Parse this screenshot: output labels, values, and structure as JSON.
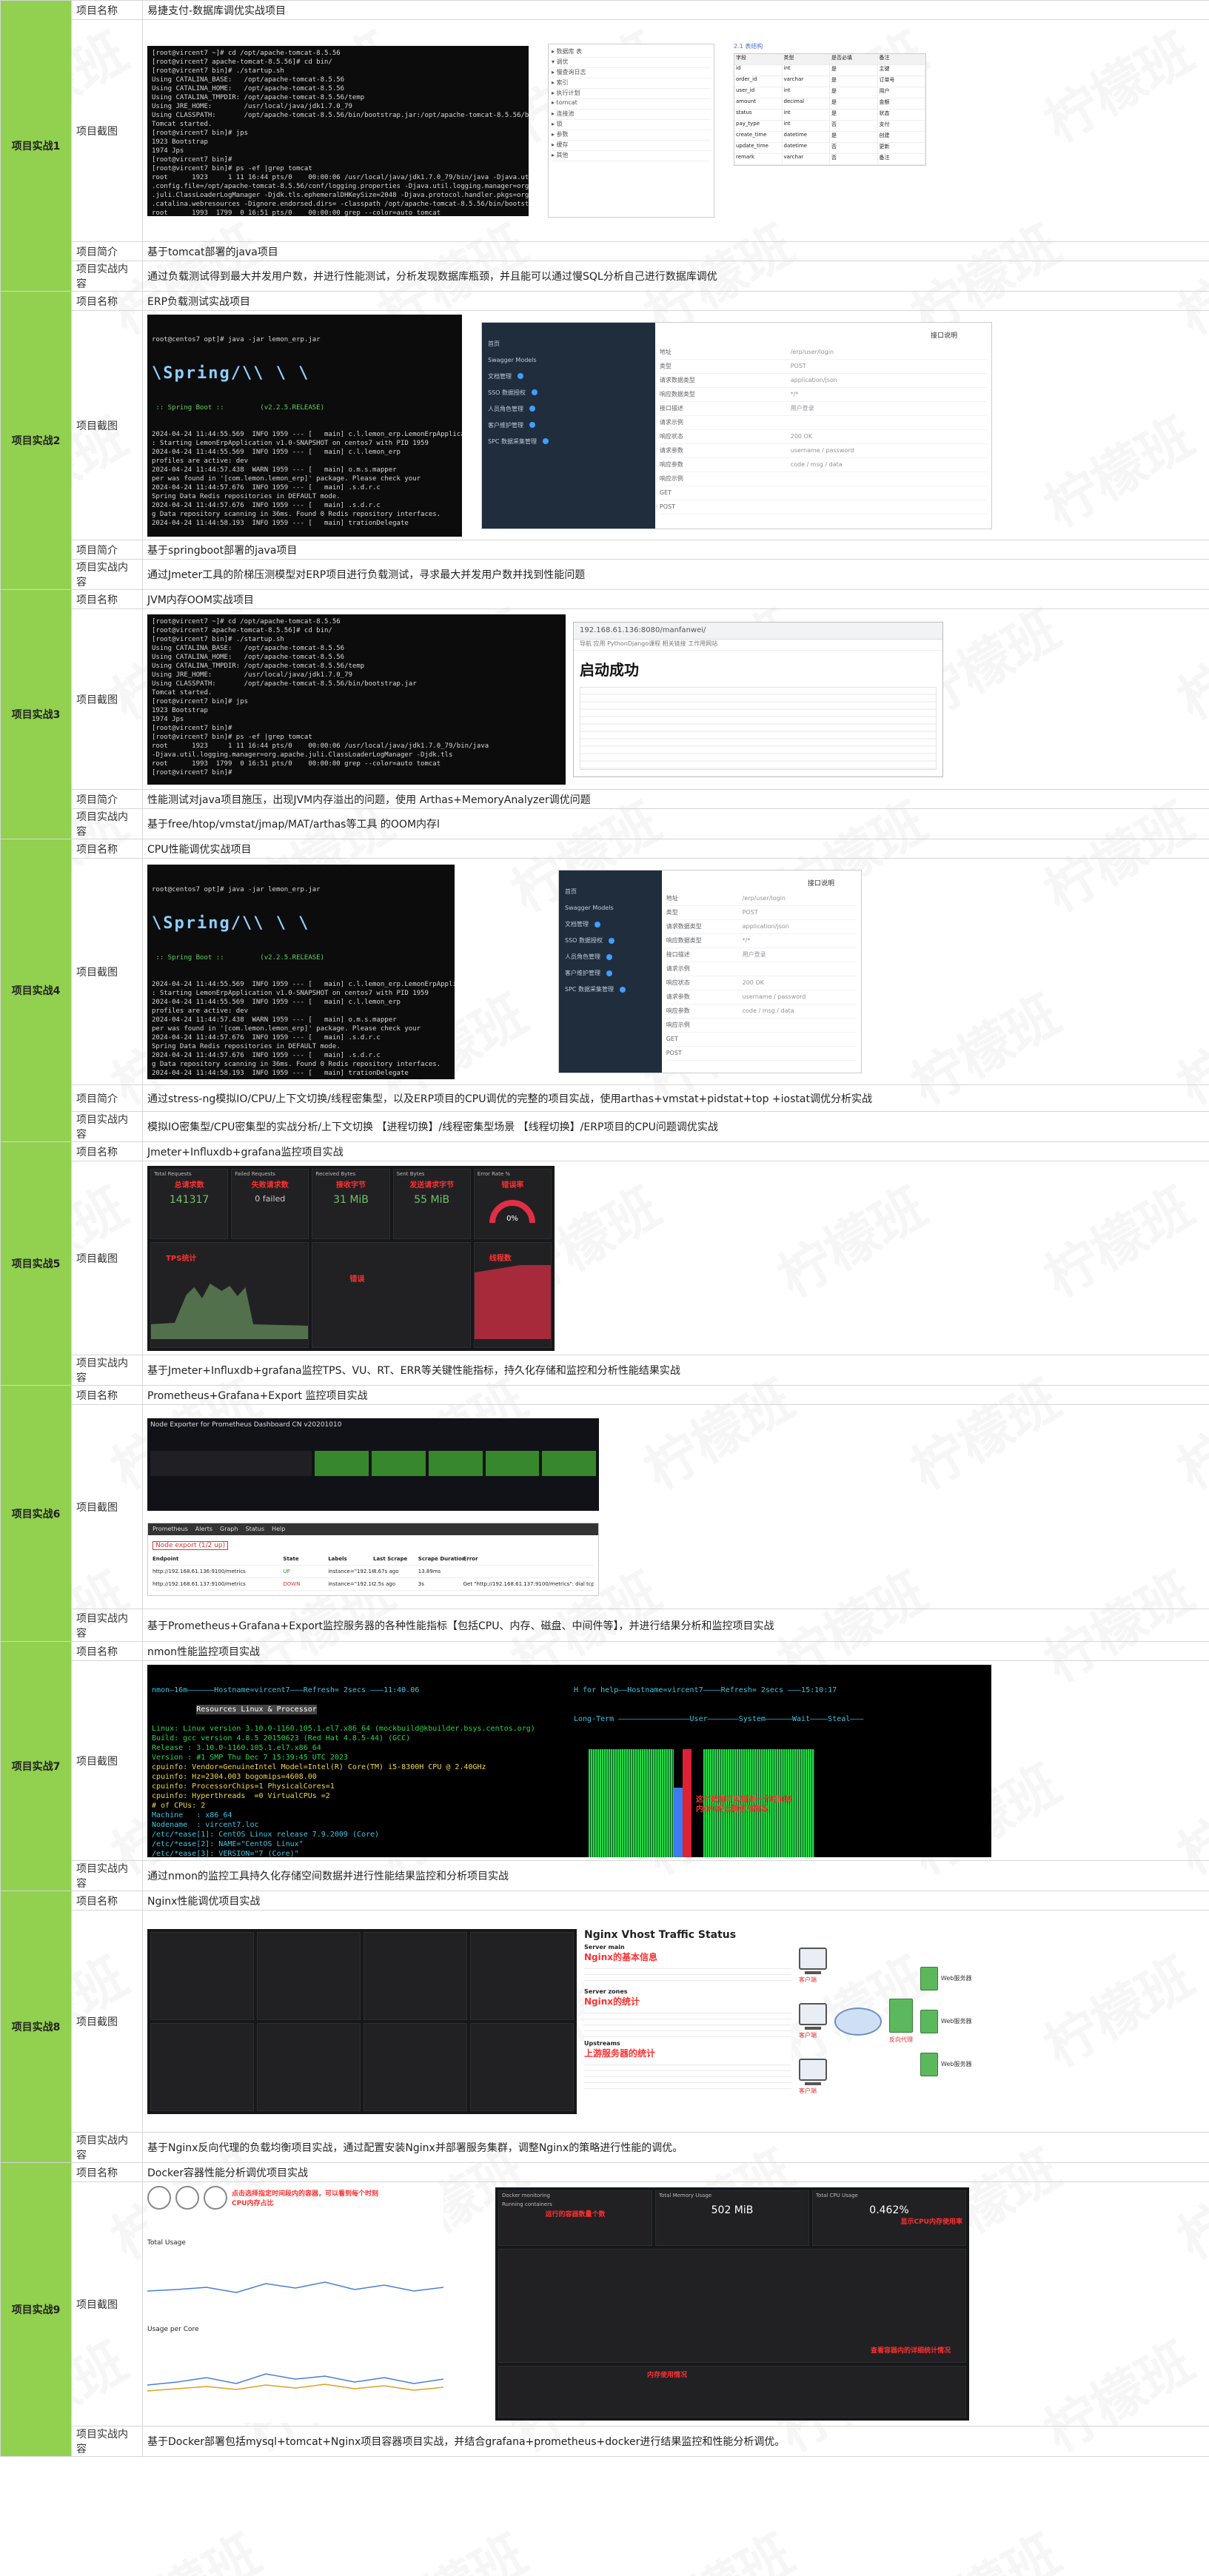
{
  "labels": {
    "name": "项目名称",
    "screenshot": "项目截图",
    "intro": "项目简介",
    "content": "项目实战内容"
  },
  "watermark": "柠檬班",
  "projects": [
    {
      "title": "项目实战1",
      "name": "易捷支付-数据库调优实战项目",
      "intro": "基于tomcat部署的java项目",
      "content": "通过负载测试得到最大并发用户数，并进行性能测试，分析发现数据库瓶颈，并且能可以通过慢SQL分析自己进行数据库调优"
    },
    {
      "title": "项目实战2",
      "name": "ERP负载测试实战项目",
      "intro": "基于springboot部署的java项目",
      "content": "通过Jmeter工具的阶梯压测模型对ERP项目进行负载测试，寻求最大并发用户数并找到性能问题"
    },
    {
      "title": "项目实战3",
      "name": "JVM内存OOM实战项目",
      "intro": "性能测试对java项目施压，出现JVM内存溢出的问题，使用 Arthas+MemoryAnalyzer调优问题",
      "content": "基于free/htop/vmstat/jmap/MAT/arthas等工具 的OOM内存l"
    },
    {
      "title": "项目实战4",
      "name": "CPU性能调优实战项目",
      "intro": "通过stress-ng模拟IO/CPU/上下文切换/线程密集型，以及ERP项目的CPU调优的完整的项目实战，使用arthas+vmstat+pidstat+top +iostat调优分析实战",
      "content": "模拟IO密集型/CPU密集型的实战分析/上下文切换 【进程切换】/线程密集型场景 【线程切换】/ERP项目的CPU问题调优实战"
    },
    {
      "title": "项目实战5",
      "name": "Jmeter+Influxdb+grafana监控项目实战",
      "content": "基于Jmeter+Influxdb+grafana监控TPS、VU、RT、ERR等关键性能指标，持久化存储和监控和分析性能结果实战"
    },
    {
      "title": "项目实战6",
      "name": "Prometheus+Grafana+Export 监控项目实战",
      "content": "基于Prometheus+Grafana+Export监控服务器的各种性能指标【包括CPU、内存、磁盘、中间件等】，并进行结果分析和监控项目实战"
    },
    {
      "title": "项目实战7",
      "name": "nmon性能监控项目实战",
      "content": "通过nmon的监控工具持久化存储空间数据并进行性能结果监控和分析项目实战"
    },
    {
      "title": "项目实战8",
      "name": "Nginx性能调优项目实战",
      "content": "基于Nginx反向代理的负载均衡项目实战，通过配置安装Nginx并部署服务集群，调整Nginx的策略进行性能的调优。"
    },
    {
      "title": "项目实战9",
      "name": "Docker容器性能分析调优项目实战",
      "content": "基于Docker部署包括mysql+tomcat+Nginx项目容器项目实战，并结合grafana+prometheus+docker进行结果监控和性能分析调优。"
    }
  ],
  "shots": {
    "p1": {
      "term": "[root@vircent7 ~]# cd /opt/apache-tomcat-8.5.56\n[root@vircent7 apache-tomcat-8.5.56]# cd bin/\n[root@vircent7 bin]# ./startup.sh\nUsing CATALINA_BASE:   /opt/apache-tomcat-8.5.56\nUsing CATALINA_HOME:   /opt/apache-tomcat-8.5.56\nUsing CATALINA_TMPDIR: /opt/apache-tomcat-8.5.56/temp\nUsing JRE_HOME:        /usr/local/java/jdk1.7.0_79\nUsing CLASSPATH:       /opt/apache-tomcat-8.5.56/bin/bootstrap.jar:/opt/apache-tomcat-8.5.56/bin/tomcat-juli.jar\nTomcat started.\n[root@vircent7 bin]# jps\n1923 Bootstrap\n1974 Jps\n[root@vircent7 bin]#\n[root@vircent7 bin]# ps -ef |grep tomcat\nroot      1923     1 11 16:44 pts/0    00:00:06 /usr/local/java/jdk1.7.0_79/bin/java -Djava.util.logging\n.config.file=/opt/apache-tomcat-8.5.56/conf/logging.properties -Djava.util.logging.manager=org.apache\n.juli.ClassLoaderLogManager -Djdk.tls.ephemeralDHKeySize=2048 -Djava.protocol.handler.pkgs=org.apache\n.catalina.webresources -Dignore.endorsed.dirs= -classpath /opt/apache-tomcat-8.5.56/bin/bootstrap.jar\nroot      1993  1799  0 16:51 pts/0    00:00:00 grep --color=auto tomcat",
      "ide": [
        "▸ 数据库 表",
        "▾ 调优",
        "  ▸ 慢查询日志",
        "  ▸ 索引",
        "  ▸ 执行计划",
        "  ▸ tomcat",
        "  ▸ 连接池",
        "  ▸ 锁",
        "  ▸ 参数",
        "  ▸ 缓存",
        "  ▸ 其他"
      ],
      "tbl_title": "2.1 表结构",
      "tbl_head": [
        "字段",
        "类型",
        "是否必填",
        "备注"
      ],
      "tbl_rows": [
        [
          "id",
          "int",
          "是",
          "主键"
        ],
        [
          "order_id",
          "varchar",
          "是",
          "订单号"
        ],
        [
          "user_id",
          "int",
          "是",
          "用户"
        ],
        [
          "amount",
          "decimal",
          "是",
          "金额"
        ],
        [
          "status",
          "int",
          "是",
          "状态"
        ],
        [
          "pay_type",
          "int",
          "否",
          "支付"
        ],
        [
          "create_time",
          "datetime",
          "是",
          "创建"
        ],
        [
          "update_time",
          "datetime",
          "否",
          "更新"
        ],
        [
          "remark",
          "varchar",
          "否",
          "备注"
        ]
      ]
    },
    "p2": {
      "prompt": "root@centos7 opt]# java -jar lemon_erp.jar",
      "logo": "\\Spring/\\\\ \\ \\",
      "boot": " :: Spring Boot ::         (v2.2.5.RELEASE)",
      "log": "2024-04-24 11:44:55.569  INFO 1959 --- [   main] c.l.lemon_erp.LemonErpApplication\n: Starting LemonErpApplication v1.0-SNAPSHOT on centos7 with PID 1959\n2024-04-24 11:44:55.569  INFO 1959 --- [   main] c.l.lemon_erp\nprofiles are active: dev\n2024-04-24 11:44:57.438  WARN 1959 --- [   main] o.m.s.mapper\nper was found in '[com.lemon.lemon_erp]' package. Please check your\n2024-04-24 11:44:57.676  INFO 1959 --- [   main] .s.d.r.c\nSpring Data Redis repositories in DEFAULT mode.\n2024-04-24 11:44:57.676  INFO 1959 --- [   main] .s.d.r.c\ng Data repository scanning in 36ms. Found 0 Redis repository interfaces.\n2024-04-24 11:44:58.193  INFO 1959 --- [   main] trationDelegate",
      "panel_menu": [
        "首页",
        "Swagger Models",
        "文档管理",
        "SSO 数据授权",
        "人员角色管理",
        "客户维护管理",
        "SPC 数据采集管理"
      ],
      "panel_head": "接口说明",
      "panel_fields": [
        [
          "地址",
          "/erp/user/login"
        ],
        [
          "类型",
          "POST"
        ],
        [
          "请求数据类型",
          "application/json"
        ],
        [
          "响应数据类型",
          "*/*"
        ],
        [
          "接口描述",
          "用户登录"
        ],
        [
          "请求示例",
          ""
        ],
        [
          "响应状态",
          "200 OK"
        ],
        [
          "请求参数",
          "username / password"
        ],
        [
          "响应参数",
          "code / msg / data"
        ],
        [
          "响应示例",
          ""
        ],
        [
          "GET",
          ""
        ],
        [
          "POST",
          ""
        ]
      ],
      "panel_title": "接口说明"
    },
    "p3": {
      "term": "[root@vircent7 ~]# cd /opt/apache-tomcat-8.5.56\n[root@vircent7 apache-tomcat-8.5.56]# cd bin/\n[root@vircent7 bin]# ./startup.sh\nUsing CATALINA_BASE:   /opt/apache-tomcat-8.5.56\nUsing CATALINA_HOME:   /opt/apache-tomcat-8.5.56\nUsing CATALINA_TMPDIR: /opt/apache-tomcat-8.5.56/temp\nUsing JRE_HOME:        /usr/local/java/jdk1.7.0_79\nUsing CLASSPATH:       /opt/apache-tomcat-8.5.56/bin/bootstrap.jar\nTomcat started.\n[root@vircent7 bin]# jps\n1923 Bootstrap\n1974 Jps\n[root@vircent7 bin]#\n[root@vircent7 bin]# ps -ef |grep tomcat\nroot      1923     1 11 16:44 pts/0    00:00:06 /usr/local/java/jdk1.7.0_79/bin/java\n-Djava.util.logging.manager=org.apache.juli.ClassLoaderLogManager -Djdk.tls\nroot      1993  1799  0 16:51 pts/0    00:00:00 grep --color=auto tomcat\n[root@vircent7 bin]#",
      "url": "192.168.61.136:8080/manfanwei/",
      "bookmarks": "导航 应用 PythonDjango课程 相关链接 工作用网站",
      "success": "启动成功"
    },
    "p4": {
      "prompt": "root@centos7 opt]# java -jar lemon_erp.jar",
      "panel_title": "接口说明"
    },
    "p5": {
      "panels": [
        {
          "t": "Total Requests",
          "v": "141317",
          "note": "总请求数"
        },
        {
          "t": "Failed Requests",
          "v": "0 failed",
          "note": "失败请求数"
        },
        {
          "t": "Received Bytes",
          "v": "31 MiB",
          "note": "接收字节"
        },
        {
          "t": "Sent Bytes",
          "v": "55 MiB",
          "note": "发送请求字节"
        },
        {
          "t": "Error Rate %",
          "v": "0%",
          "note": "错误率"
        }
      ],
      "tps_title": "TPS统计",
      "err_title": "错误",
      "active_title": "线程数"
    },
    "p6": {
      "head": "Node Exporter for Prometheus Dashboard CN v20201010",
      "tabs": [
        "Prometheus",
        "Alerts",
        "Graph",
        "Status",
        "Help"
      ],
      "node_label": "Node export (1/2 up)",
      "cols": [
        "Endpoint",
        "State",
        "Labels",
        "Last Scrape",
        "Scrape Duration",
        "Error"
      ],
      "rows": [
        [
          "http://192.168.61.136:9100/metrics",
          "UP",
          "instance=\"192.168.61.136:9100\"",
          "8.67s ago",
          "13.89ms",
          ""
        ],
        [
          "http://192.168.61.137:9100/metrics",
          "DOWN",
          "instance=\"192.168.61.137:9100\"",
          "2.5s ago",
          "3s",
          "Get \"http://192.168.61.137:9100/metrics\": dial tcp"
        ]
      ]
    },
    "p7": {
      "head": "nmon—16m——————Hostname=vircent7———Refresh= 2secs ———11:40.06",
      "title": "Resources Linux & Processor",
      "lines": [
        "Linux: Linux version 3.10.0-1160.105.1.el7.x86_64 (mockbuild@kbuilder.bsys.centos.org)",
        "Build: gcc version 4.8.5 20150623 (Red Hat 4.8.5-44) (GCC)",
        "Release : 3.10.0-1160.105.1.el7.x86_64",
        "Version : #1 SMP Thu Dec 7 15:39:45 UTC 2023",
        "cpuinfo: Vendor=GenuineIntel Model=Intel(R) Core(TM) i5-8300H CPU @ 2.40GHz",
        "cpuinfo: Hz=2304.003 bogomips=4608.00",
        "cpuinfo: ProcessorChips=1 PhysicalCores=1",
        "cpuinfo: Hyperthreads  =0 VirtualCPUs =2",
        "# of CPUs: 2",
        "Machine   : x86_64",
        "Nodename  : vircent7.loc",
        "/etc/*ease[1]: CentOS Linux release 7.9.2009 (Core)",
        "/etc/*ease[2]: NAME=\"CentOS Linux\"",
        "/etc/*ease[3]: VERSION=\"7 (Core)\"",
        "/etc/*ease[4]: ID=\"centos\"",
        "lsb_release: Not found",
        "lsb_release: Null",
        "lsb_release: Null"
      ],
      "right_head": "H for help——Hostname=vircent7————Refresh= 2secs ———15:10:17",
      "right_sub": "Long-Term ————————————————User———————System——————Wait————Steal———",
      "annotation": "这个数值可以看到一个时间段内CPU的运算使用情况"
    },
    "p8": {
      "title": "Nginx Vhost Traffic Status",
      "server_main": "Server main",
      "server_zones": "Server zones",
      "upstreams": "Upstreams",
      "note1": "Nginx的基本信息",
      "note2": "Nginx的统计",
      "note3": "上游服务器的统计",
      "client": "客户端",
      "proxy": "反向代理",
      "server": "Web服务器"
    },
    "p9": {
      "left_note": "点击选择指定时间段内的容器，可以看到每个时刻CPU内存占比",
      "total_usage": "Total Usage",
      "usage_per_core": "Usage per Core",
      "right_title": "Docker monitoring",
      "running": "Running containers",
      "running_note": "运行的容器数量个数",
      "mem_val": "502 MiB",
      "mem_title": "Total Memory Usage",
      "cpu_val": "0.462%",
      "cpu_title": "Total CPU Usage",
      "cpu_note": "显示CPU内存使用率",
      "mem_note": "内存使用情况",
      "net_note": "查看容器内的详细统计情况"
    }
  }
}
